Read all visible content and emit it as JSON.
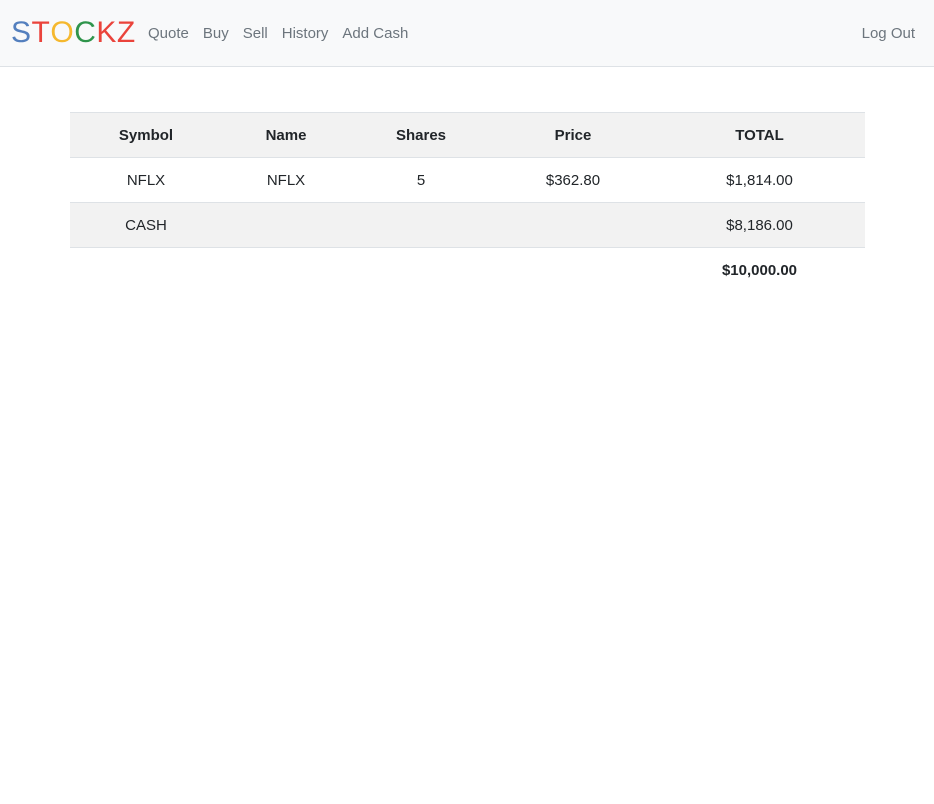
{
  "brand": {
    "letters": [
      {
        "char": "S",
        "color": "#537fbe"
      },
      {
        "char": "T",
        "color": "#ea433b"
      },
      {
        "char": "O",
        "color": "#f5b82e"
      },
      {
        "char": "C",
        "color": "#2e944b"
      },
      {
        "char": "K",
        "color": "#ea433b"
      },
      {
        "char": "Z",
        "color": "#ea433b"
      }
    ]
  },
  "nav": {
    "items": [
      {
        "label": "Quote"
      },
      {
        "label": "Buy"
      },
      {
        "label": "Sell"
      },
      {
        "label": "History"
      },
      {
        "label": "Add Cash"
      }
    ],
    "logout_label": "Log Out"
  },
  "table": {
    "headers": [
      "Symbol",
      "Name",
      "Shares",
      "Price",
      "TOTAL"
    ],
    "rows": [
      {
        "symbol": "NFLX",
        "name": "NFLX",
        "shares": "5",
        "price": "$362.80",
        "total": "$1,814.00"
      }
    ],
    "cash": {
      "label": "CASH",
      "total": "$8,186.00"
    },
    "grand_total": "$10,000.00"
  }
}
